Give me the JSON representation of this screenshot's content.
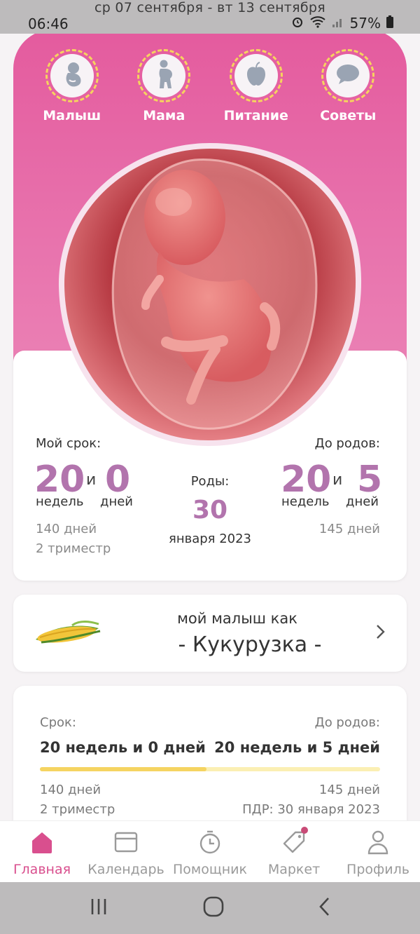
{
  "status": {
    "time": "06:46",
    "battery": "57%"
  },
  "week_range": "ср 07 сентября - вт 13 сентября",
  "top_nav": [
    {
      "label": "Малыш",
      "icon": "baby-icon"
    },
    {
      "label": "Мама",
      "icon": "pregnant-woman-icon"
    },
    {
      "label": "Питание",
      "icon": "apple-icon"
    },
    {
      "label": "Советы",
      "icon": "chat-bubble-icon"
    }
  ],
  "term": {
    "title": "Мой срок:",
    "weeks": "20",
    "and": "и",
    "days": "0",
    "weeks_unit": "недель",
    "days_unit": "дней",
    "total_days": "140 дней",
    "trimester": "2 триместр"
  },
  "birth": {
    "title": "Роды:",
    "day": "30",
    "month_year": "января 2023"
  },
  "until": {
    "title": "До родов:",
    "weeks": "20",
    "and": "и",
    "days": "5",
    "weeks_unit": "недель",
    "days_unit": "дней",
    "total_days": "145 дней"
  },
  "baby_size": {
    "subtitle": "мой малыш как",
    "name": "- Кукурузка -"
  },
  "progress": {
    "term_label": "Срок:",
    "term_value": "20 недель и 0 дней",
    "until_label": "До родов:",
    "until_value": "20 недель и 5 дней",
    "fraction": 0.49,
    "left_days": "140 дней",
    "left_trimester": "2 триместр",
    "right_days": "145 дней",
    "pdr": "ПДР: 30 января 2023"
  },
  "bottom_nav": [
    {
      "label": "Главная",
      "icon": "home-icon",
      "active": true
    },
    {
      "label": "Календарь",
      "icon": "calendar-icon",
      "active": false
    },
    {
      "label": "Помощник",
      "icon": "timer-icon",
      "active": false
    },
    {
      "label": "Маркет",
      "icon": "tag-icon",
      "active": false
    },
    {
      "label": "Профиль",
      "icon": "profile-icon",
      "active": false
    }
  ],
  "colors": {
    "accent": "#d94f8e",
    "number": "#b274ad",
    "progress": "#f5d461"
  }
}
